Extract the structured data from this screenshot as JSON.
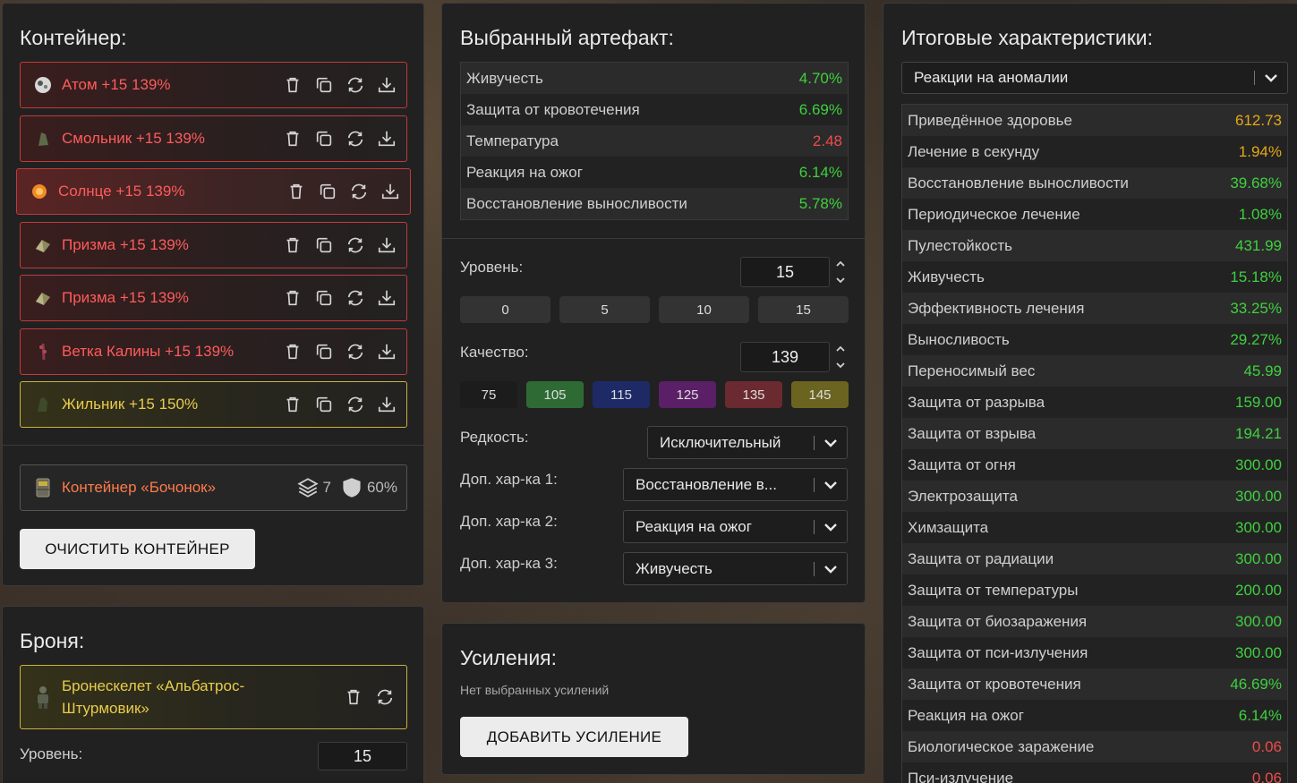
{
  "container": {
    "title": "Контейнер:",
    "items": [
      {
        "label": "Атом +15 139%",
        "icon": "atom-artifact-icon",
        "style": "red"
      },
      {
        "label": "Смольник +15 139%",
        "icon": "resin-artifact-icon",
        "style": "red"
      },
      {
        "label": "Солнце +15 139%",
        "icon": "sun-artifact-icon",
        "style": "red-active"
      },
      {
        "label": "Призма +15 139%",
        "icon": "prism-artifact-icon",
        "style": "red"
      },
      {
        "label": "Призма +15 139%",
        "icon": "prism-artifact-icon",
        "style": "red"
      },
      {
        "label": "Ветка Калины +15 139%",
        "icon": "viburnum-branch-artifact-icon",
        "style": "red"
      },
      {
        "label": "Жильник +15 150%",
        "icon": "vein-artifact-icon",
        "style": "yellow"
      }
    ],
    "barrel": {
      "label": "Контейнер «Бочонок»",
      "slots": "7",
      "protection": "60%"
    },
    "clear_button": "ОЧИСТИТЬ КОНТЕЙНЕР"
  },
  "armor": {
    "title": "Броня:",
    "item_label": "Бронескелет «Альбатрос-Штурмовик»",
    "level_label": "Уровень:",
    "level_value": "15"
  },
  "artifact": {
    "title": "Выбранный артефакт:",
    "stats": [
      {
        "name": "Живучесть",
        "value": "4.70%",
        "color": "green"
      },
      {
        "name": "Защита от кровотечения",
        "value": "6.69%",
        "color": "green"
      },
      {
        "name": "Температура",
        "value": "2.48",
        "color": "red"
      },
      {
        "name": "Реакция на ожог",
        "value": "6.14%",
        "color": "green"
      },
      {
        "name": "Восстановление выносливости",
        "value": "5.78%",
        "color": "green"
      }
    ],
    "level_label": "Уровень:",
    "level_value": "15",
    "level_presets": [
      "0",
      "5",
      "10",
      "15"
    ],
    "quality_label": "Качество:",
    "quality_value": "139",
    "quality_presets": [
      {
        "label": "75",
        "color": "#1c1c1c"
      },
      {
        "label": "105",
        "color": "#2e6b34"
      },
      {
        "label": "115",
        "color": "#1e2a66"
      },
      {
        "label": "125",
        "color": "#5a1f66"
      },
      {
        "label": "135",
        "color": "#6b2a2f"
      },
      {
        "label": "145",
        "color": "#6b6420"
      }
    ],
    "rarity_label": "Редкость:",
    "rarity_value": "Исключительный",
    "extra1_label": "Доп. хар-ка 1:",
    "extra1_value": "Восстановление в...",
    "extra2_label": "Доп. хар-ка 2:",
    "extra2_value": "Реакция на ожог",
    "extra3_label": "Доп. хар-ка 3:",
    "extra3_value": "Живучесть"
  },
  "enhancements": {
    "title": "Усиления:",
    "empty_text": "Нет выбранных усилений",
    "add_button": "ДОБАВИТЬ УСИЛЕНИЕ"
  },
  "totals": {
    "title": "Итоговые характеристики:",
    "filter_value": "Реакции на аномалии",
    "stats": [
      {
        "name": "Приведённое здоровье",
        "value": "612.73",
        "color": "orange"
      },
      {
        "name": "Лечение в секунду",
        "value": "1.94%",
        "color": "orange"
      },
      {
        "name": "Восстановление выносливости",
        "value": "39.68%",
        "color": "green"
      },
      {
        "name": "Периодическое лечение",
        "value": "1.08%",
        "color": "green"
      },
      {
        "name": "Пулестойкость",
        "value": "431.99",
        "color": "green"
      },
      {
        "name": "Живучесть",
        "value": "15.18%",
        "color": "green"
      },
      {
        "name": "Эффективность лечения",
        "value": "33.25%",
        "color": "green"
      },
      {
        "name": "Выносливость",
        "value": "29.27%",
        "color": "green"
      },
      {
        "name": "Переносимый вес",
        "value": "45.99",
        "color": "green"
      },
      {
        "name": "Защита от разрыва",
        "value": "159.00",
        "color": "green"
      },
      {
        "name": "Защита от взрыва",
        "value": "194.21",
        "color": "green"
      },
      {
        "name": "Защита от огня",
        "value": "300.00",
        "color": "green"
      },
      {
        "name": "Электрозащита",
        "value": "300.00",
        "color": "green"
      },
      {
        "name": "Химзащита",
        "value": "300.00",
        "color": "green"
      },
      {
        "name": "Защита от радиации",
        "value": "300.00",
        "color": "green"
      },
      {
        "name": "Защита от температуры",
        "value": "200.00",
        "color": "green"
      },
      {
        "name": "Защита от биозаражения",
        "value": "300.00",
        "color": "green"
      },
      {
        "name": "Защита от пси-излучения",
        "value": "300.00",
        "color": "green"
      },
      {
        "name": "Защита от кровотечения",
        "value": "46.69%",
        "color": "green"
      },
      {
        "name": "Реакция на ожог",
        "value": "6.14%",
        "color": "green"
      },
      {
        "name": "Биологическое заражение",
        "value": "0.06",
        "color": "red"
      },
      {
        "name": "Пси-излучение",
        "value": "0.06",
        "color": "red"
      }
    ]
  }
}
